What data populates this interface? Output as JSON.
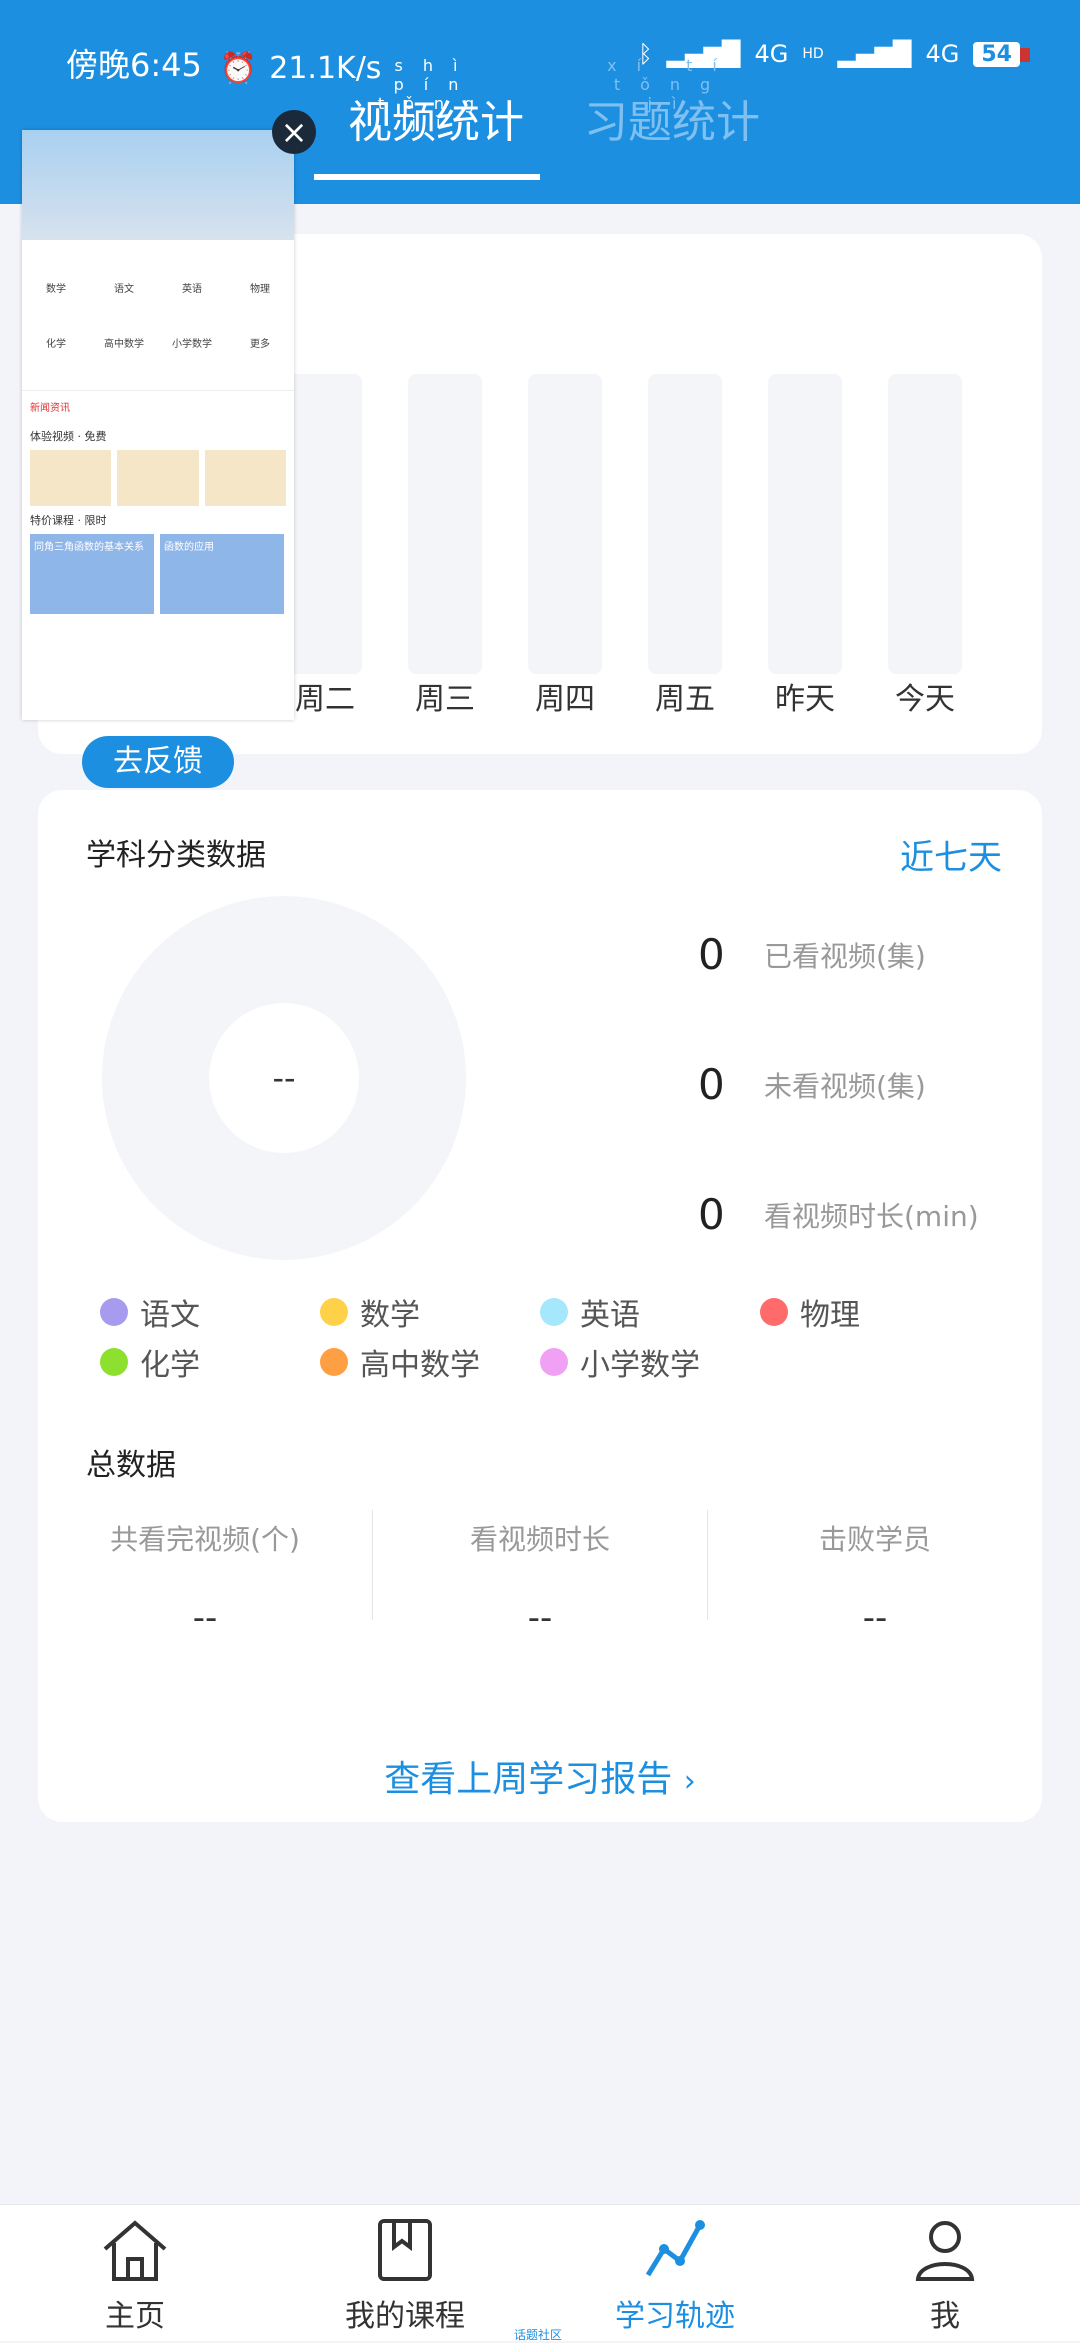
{
  "status_bar": {
    "time": "傍晚6:45",
    "speed": "21.1K/s",
    "network1": "4G",
    "network2": "4G",
    "hd": "HD",
    "battery": "54"
  },
  "tabs": [
    {
      "label": "视频统计",
      "ruby": "shì pín tǒng jì",
      "active": true
    },
    {
      "label": "习题统计",
      "ruby": "xí tí tǒng jì",
      "active": false
    }
  ],
  "weekly_chart": {
    "days": [
      "周二",
      "周三",
      "周四",
      "周五",
      "昨天",
      "今天"
    ],
    "values": [
      0,
      0,
      0,
      0,
      0,
      0
    ]
  },
  "overlay_preview": {
    "subjects": [
      "数学",
      "语文",
      "英语",
      "物理",
      "化学",
      "高中数学",
      "小学数学",
      "更多"
    ],
    "news_label": "新闻资讯",
    "section1": "体验视频 · 免费",
    "section2": "特价课程 · 限时",
    "thumb1": "同角三角函数的基本关系",
    "thumb2": "函数的应用"
  },
  "feedback_button": "去反馈",
  "subject_card": {
    "title": "学科分类数据",
    "range": "近七天",
    "center": "--",
    "stats": [
      {
        "value": "0",
        "label": "已看视频(集)"
      },
      {
        "value": "0",
        "label": "未看视频(集)"
      },
      {
        "value": "0",
        "label": "看视频时长(min)"
      }
    ],
    "legend": [
      {
        "name": "语文",
        "color": "#a79bf0"
      },
      {
        "name": "数学",
        "color": "#ffd149"
      },
      {
        "name": "英语",
        "color": "#a5e8fb"
      },
      {
        "name": "物理",
        "color": "#ff6b6b"
      },
      {
        "name": "化学",
        "color": "#8ee030"
      },
      {
        "name": "高中数学",
        "color": "#ff9f43"
      },
      {
        "name": "小学数学",
        "color": "#f1a1f3"
      }
    ]
  },
  "totals": {
    "title": "总数据",
    "items": [
      {
        "label": "共看完视频(个)",
        "value": "--"
      },
      {
        "label": "看视频时长",
        "value": "--"
      },
      {
        "label": "击败学员",
        "value": "--"
      }
    ]
  },
  "report_link": "查看上周学习报告",
  "bottom_nav": [
    {
      "label": "主页",
      "icon": "home-icon",
      "active": false
    },
    {
      "label": "我的课程",
      "icon": "book-icon",
      "active": false
    },
    {
      "label": "学习轨迹",
      "icon": "trend-icon",
      "active": true
    },
    {
      "label": "我",
      "icon": "user-icon",
      "active": false
    }
  ],
  "community_label": "话题社区"
}
